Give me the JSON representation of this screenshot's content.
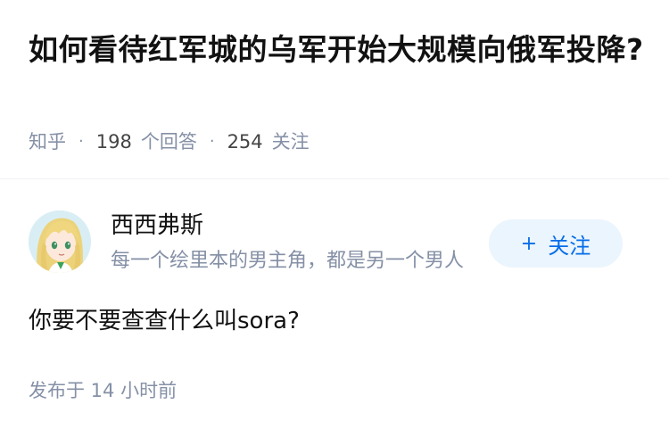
{
  "question": {
    "title": "如何看待红军城的乌军开始大规模向俄军投降?",
    "site_name": "知乎",
    "separator": "·",
    "answer_count": "198",
    "answer_count_label": "个回答",
    "follower_count": "254",
    "follower_count_label": "关注"
  },
  "answer": {
    "author": {
      "name": "西西弗斯",
      "bio": "每一个绘里本的男主角，都是另一个男人",
      "avatar_icon": "anime-girl-avatar",
      "follow_plus": "+",
      "follow_label": "关注"
    },
    "content": "你要不要查查什么叫sora?",
    "time": "发布于 14 小时前"
  },
  "colors": {
    "title": "#121212",
    "meta": "#8590a6",
    "follow_bg": "#ebf5fd",
    "follow_text": "#056de8",
    "divider": "#f0f2f7"
  }
}
